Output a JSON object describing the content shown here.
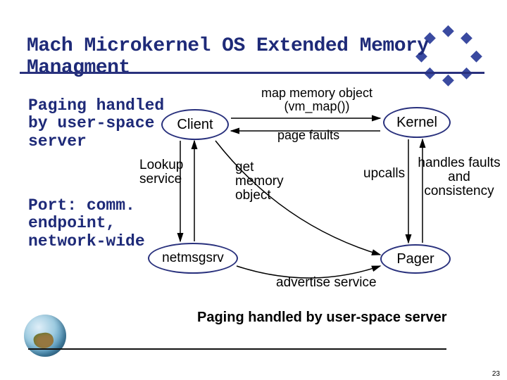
{
  "title": "Mach Microkernel OS Extended Memory Managment",
  "notes": {
    "paging": "Paging handled\nby user-space\nserver",
    "port": "Port: comm.\nendpoint,\nnetwork-wide"
  },
  "nodes": {
    "client": "Client",
    "kernel": "Kernel",
    "netmsgsrv": "netmsgsrv",
    "pager": "Pager"
  },
  "labels": {
    "map_memory": "map memory object\n(vm_map())",
    "page_faults": "page faults",
    "lookup_service": "Lookup\nservice",
    "get_memory_object": "get\nmemory\nobject",
    "upcalls": "upcalls",
    "handles": "handles faults\nand\nconsistency",
    "advertise": "advertise service"
  },
  "footer": "Paging handled by user-space server",
  "page_number": "23",
  "colors": {
    "accent": "#29317d"
  }
}
